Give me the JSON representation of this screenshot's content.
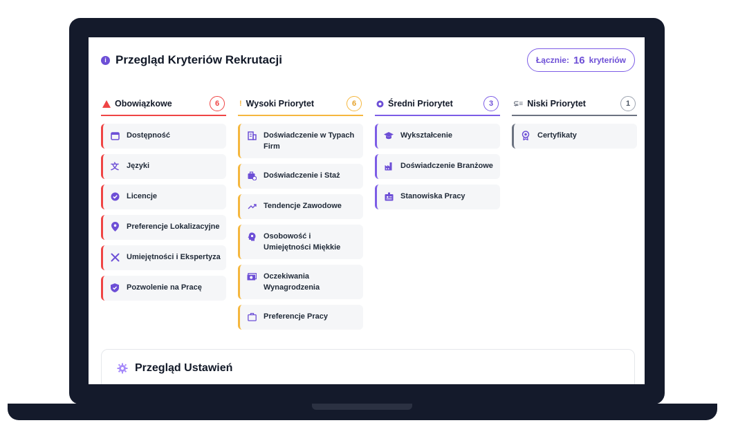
{
  "header": {
    "title": "Przegląd Kryteriów Rekrutacji",
    "total_prefix": "Łącznie:",
    "total_count": "16",
    "total_suffix": "kryteriów"
  },
  "columns": [
    {
      "title": "Obowiązkowe",
      "count": "6",
      "icon": "warning-triangle-icon",
      "color": "#ef4444",
      "items": [
        {
          "label": "Dostępność",
          "icon": "calendar-icon"
        },
        {
          "label": "Języki",
          "icon": "translate-icon"
        },
        {
          "label": "Licencje",
          "icon": "verified-badge-icon"
        },
        {
          "label": "Preferencje Lokalizacyjne",
          "icon": "location-pin-icon"
        },
        {
          "label": "Umiejętności i Ekspertyza",
          "icon": "tools-icon"
        },
        {
          "label": "Pozwolenie na Pracę",
          "icon": "shield-check-icon"
        }
      ]
    },
    {
      "title": "Wysoki Priorytet",
      "count": "6",
      "icon": "exclamation-icon",
      "color": "#f5b73e",
      "items": [
        {
          "label": "Doświadczenie w Typach Firm",
          "icon": "building-icon"
        },
        {
          "label": "Doświadczenie i Staż",
          "icon": "briefcase-clock-icon"
        },
        {
          "label": "Tendencje Zawodowe",
          "icon": "trending-up-icon"
        },
        {
          "label": "Osobowość i Umiejętności Miękkie",
          "icon": "head-icon"
        },
        {
          "label": "Oczekiwania Wynagrodzenia",
          "icon": "money-icon"
        },
        {
          "label": "Preferencje Pracy",
          "icon": "briefcase-icon"
        }
      ]
    },
    {
      "title": "Średni Priorytet",
      "count": "3",
      "icon": "dot-circle-icon",
      "color": "#7c5ce6",
      "items": [
        {
          "label": "Wykształcenie",
          "icon": "graduation-cap-icon"
        },
        {
          "label": "Doświadczenie Branżowe",
          "icon": "factory-icon"
        },
        {
          "label": "Stanowiska Pracy",
          "icon": "id-badge-icon"
        }
      ]
    },
    {
      "title": "Niski Priorytet",
      "count": "1",
      "icon": "low-priority-icon",
      "color": "#6b7280",
      "items": [
        {
          "label": "Certyfikaty",
          "icon": "award-icon"
        }
      ]
    }
  ],
  "settings": {
    "title": "Przegląd Ustawień"
  }
}
